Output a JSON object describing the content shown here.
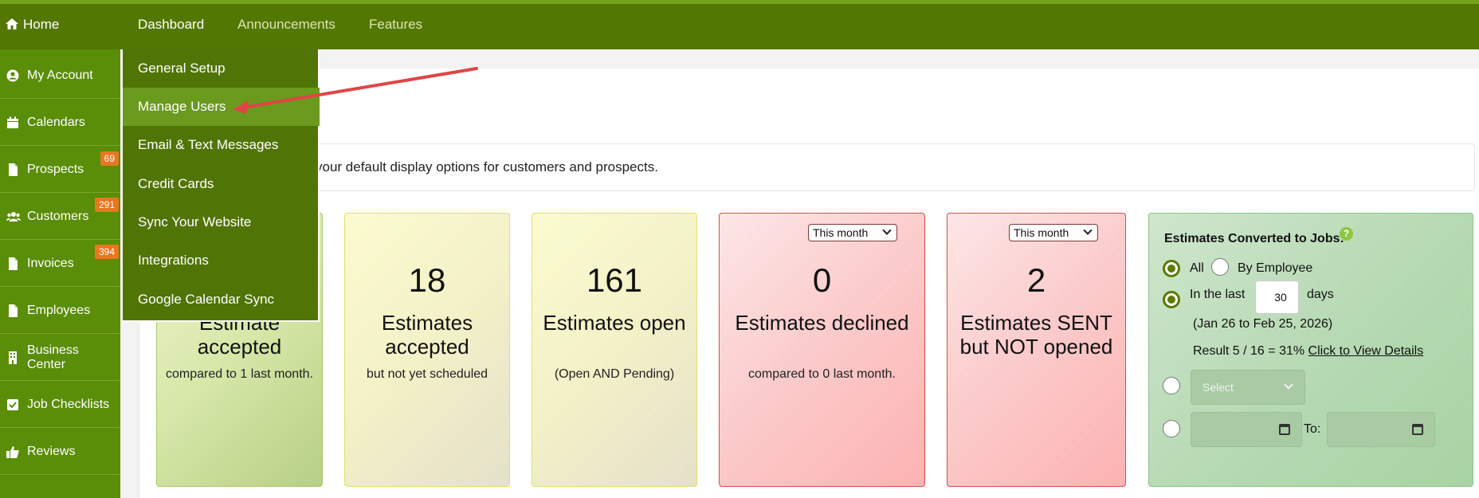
{
  "topnav": {
    "home": "Home",
    "tabs": [
      "Dashboard",
      "Announcements",
      "Features"
    ],
    "active": "Dashboard"
  },
  "sidebar": {
    "items": [
      {
        "label": "My Account",
        "icon": "user-circle-icon"
      },
      {
        "label": "Calendars",
        "icon": "calendar-icon"
      },
      {
        "label": "Prospects",
        "icon": "file-icon",
        "badge": "69"
      },
      {
        "label": "Customers",
        "icon": "users-icon",
        "badge": "291"
      },
      {
        "label": "Invoices",
        "icon": "file-icon",
        "badge": "394"
      },
      {
        "label": "Employees",
        "icon": "file-icon"
      },
      {
        "label": "Business Center",
        "icon": "building-icon"
      },
      {
        "label": "Job Checklists",
        "icon": "checkbox-icon"
      },
      {
        "label": "Reviews",
        "icon": "thumbs-up-icon"
      }
    ]
  },
  "dropdown": {
    "items": [
      "General Setup",
      "Manage Users",
      "Email & Text Messages",
      "Credit Cards",
      "Sync Your Website",
      "Integrations",
      "Google Calendar Sync"
    ],
    "highlighted": "Manage Users"
  },
  "notice": {
    "text": "your default display options for customers and prospects."
  },
  "cards": [
    {
      "number": "",
      "label": "Estimate accepted",
      "sub": "compared to 1 last month."
    },
    {
      "number": "18",
      "label": "Estimates accepted",
      "sub": "but not yet scheduled"
    },
    {
      "number": "161",
      "label": "Estimates open",
      "sub": "(Open AND Pending)"
    },
    {
      "number": "0",
      "label": "Estimates declined",
      "sub": "compared to 0 last month.",
      "select": "This month"
    },
    {
      "number": "2",
      "label": "Estimates SENT but NOT opened",
      "sub": "",
      "select": "This month"
    }
  ],
  "conversion": {
    "title": "Estimates Converted to Jobs:",
    "help": "?",
    "opt_all": "All",
    "opt_employee": "By Employee",
    "in_the_last": "In the last",
    "days_value": "30",
    "days": "days",
    "range": "(Jan 26 to Feb 25, 2026)",
    "result": "Result 5 / 16 = 31%",
    "details_link": "Click to View Details",
    "select_placeholder": "Select",
    "to": "To:"
  },
  "colors": {
    "topbar": "#537703",
    "sidebar": "#5a8d08",
    "dropdown": "#517406",
    "badge": "#e87722",
    "arrow": "#e04545"
  }
}
